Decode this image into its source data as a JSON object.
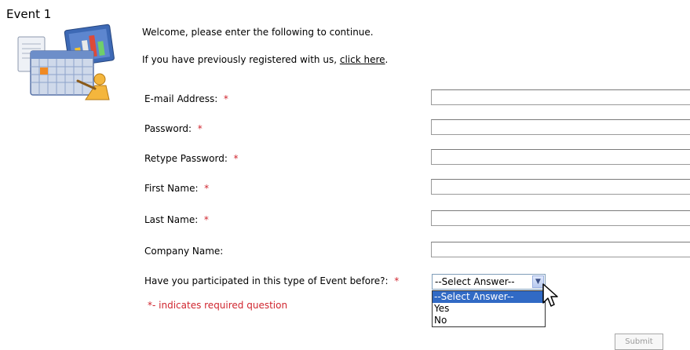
{
  "page": {
    "event_title": "Event 1"
  },
  "intro": {
    "welcome": "Welcome, please enter the following to continue.",
    "registered_prefix": "If you have previously registered with us, ",
    "registered_link": "click here",
    "registered_suffix": "."
  },
  "form": {
    "required_mark": "*",
    "fields": [
      {
        "label": "E-mail Address:",
        "required": true,
        "value": ""
      },
      {
        "label": "Password:",
        "required": true,
        "value": ""
      },
      {
        "label": "Retype Password:",
        "required": true,
        "value": ""
      },
      {
        "label": "First Name:",
        "required": true,
        "value": ""
      },
      {
        "label": "Last Name:",
        "required": true,
        "value": ""
      },
      {
        "label": "Company Name:",
        "required": false,
        "value": ""
      }
    ],
    "question": {
      "label": "Have you participated in this type of Event before?:",
      "required": true,
      "selected": "--Select Answer--",
      "options": [
        "--Select Answer--",
        "Yes",
        "No"
      ]
    },
    "required_note": "*- indicates required question",
    "submit_label": "Submit"
  },
  "colors": {
    "required": "#d0262f",
    "selection": "#316ac5"
  }
}
